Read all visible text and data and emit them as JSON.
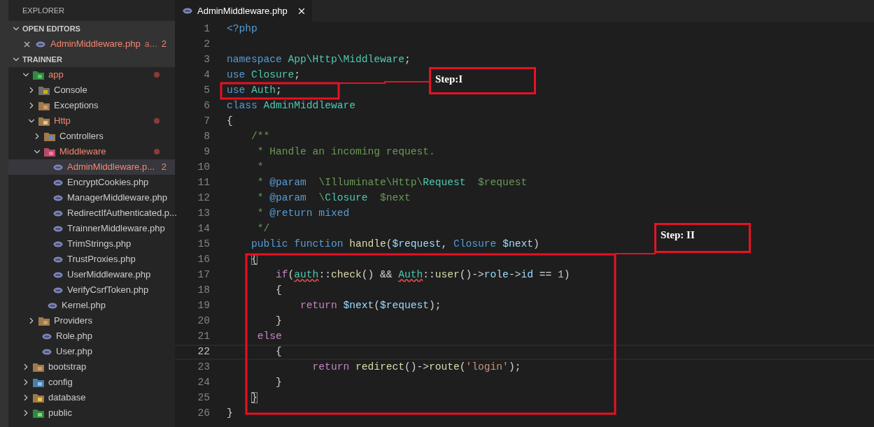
{
  "sidebar": {
    "title": "EXPLORER",
    "open_editors": {
      "title": "OPEN EDITORS",
      "expanded": true,
      "items": [
        {
          "label": "AdminMiddleware.php",
          "detail": "a…",
          "badge": "2",
          "problem": true
        }
      ]
    },
    "workspace": {
      "title": "TRAINNER",
      "expanded": true,
      "items": [
        {
          "label": "app",
          "kind": "folder-app",
          "expanded": true,
          "modified": true,
          "problem": true,
          "selected": false,
          "children": [
            {
              "label": "Console",
              "kind": "folder-console",
              "expanded": false,
              "modified": false,
              "problem": false,
              "selected": false
            },
            {
              "label": "Exceptions",
              "kind": "folder",
              "expanded": false,
              "modified": false,
              "problem": false,
              "selected": false
            },
            {
              "label": "Http",
              "kind": "folder-open",
              "expanded": true,
              "modified": true,
              "problem": true,
              "selected": false,
              "children": [
                {
                  "label": "Controllers",
                  "kind": "folder-controllers",
                  "expanded": false,
                  "modified": false,
                  "problem": false,
                  "selected": false
                },
                {
                  "label": "Middleware",
                  "kind": "folder-middleware",
                  "expanded": true,
                  "modified": true,
                  "problem": true,
                  "selected": false,
                  "children": [
                    {
                      "label": "AdminMiddleware.p...",
                      "kind": "php",
                      "badge": "2",
                      "modified": false,
                      "problem": true,
                      "selected": true
                    },
                    {
                      "label": "EncryptCookies.php",
                      "kind": "php",
                      "modified": false,
                      "problem": false,
                      "selected": false
                    },
                    {
                      "label": "ManagerMiddleware.php",
                      "kind": "php",
                      "modified": false,
                      "problem": false,
                      "selected": false
                    },
                    {
                      "label": "RedirectIfAuthenticated.p...",
                      "kind": "php",
                      "modified": false,
                      "problem": false,
                      "selected": false
                    },
                    {
                      "label": "TrainnerMiddleware.php",
                      "kind": "php",
                      "modified": false,
                      "problem": false,
                      "selected": false
                    },
                    {
                      "label": "TrimStrings.php",
                      "kind": "php",
                      "modified": false,
                      "problem": false,
                      "selected": false
                    },
                    {
                      "label": "TrustProxies.php",
                      "kind": "php",
                      "modified": false,
                      "problem": false,
                      "selected": false
                    },
                    {
                      "label": "UserMiddleware.php",
                      "kind": "php",
                      "modified": false,
                      "problem": false,
                      "selected": false
                    },
                    {
                      "label": "VerifyCsrfToken.php",
                      "kind": "php",
                      "modified": false,
                      "problem": false,
                      "selected": false
                    }
                  ]
                },
                {
                  "label": "Kernel.php",
                  "kind": "php",
                  "modified": false,
                  "problem": false,
                  "selected": false
                }
              ]
            },
            {
              "label": "Providers",
              "kind": "folder",
              "expanded": false,
              "modified": false,
              "problem": false,
              "selected": false
            },
            {
              "label": "Role.php",
              "kind": "php",
              "modified": false,
              "problem": false,
              "selected": false
            },
            {
              "label": "User.php",
              "kind": "php",
              "modified": false,
              "problem": false,
              "selected": false
            }
          ]
        },
        {
          "label": "bootstrap",
          "kind": "folder",
          "expanded": false,
          "modified": false,
          "problem": false,
          "selected": false
        },
        {
          "label": "config",
          "kind": "folder-config",
          "expanded": false,
          "modified": false,
          "problem": false,
          "selected": false
        },
        {
          "label": "database",
          "kind": "folder-database",
          "expanded": false,
          "modified": false,
          "problem": false,
          "selected": false
        },
        {
          "label": "public",
          "kind": "folder-public",
          "expanded": false,
          "modified": false,
          "problem": false,
          "selected": false
        }
      ]
    }
  },
  "tabs": [
    {
      "label": "AdminMiddleware.php",
      "selected": true
    }
  ],
  "editor": {
    "lines": [
      {
        "number": "1",
        "current": false,
        "tokens": [
          {
            "kind": "keyword",
            "text": "<?php"
          }
        ]
      },
      {
        "number": "2",
        "current": false
      },
      {
        "number": "3",
        "current": false,
        "tokens": [
          {
            "kind": "keyword",
            "text": "namespace"
          },
          {
            "kind": "type",
            "text": " App\\Http\\Middleware"
          },
          {
            "kind": "plain",
            "text": ";"
          }
        ]
      },
      {
        "number": "4",
        "current": false,
        "tokens": [
          {
            "kind": "keyword",
            "text": "use"
          },
          {
            "kind": "type",
            "text": " Closure"
          },
          {
            "kind": "plain",
            "text": ";"
          }
        ]
      },
      {
        "number": "5",
        "current": false,
        "tokens": [
          {
            "kind": "keyword",
            "text": "use"
          },
          {
            "kind": "type",
            "text": " Auth"
          },
          {
            "kind": "plain",
            "text": ";"
          }
        ]
      },
      {
        "number": "6",
        "current": false,
        "tokens": [
          {
            "kind": "keyword",
            "text": "class"
          },
          {
            "kind": "type",
            "text": " AdminMiddleware"
          }
        ]
      },
      {
        "number": "7",
        "current": false,
        "tokens": [
          {
            "kind": "plain",
            "text": "{"
          }
        ]
      },
      {
        "number": "8",
        "current": false,
        "tokens": [
          {
            "kind": "comment",
            "text": "    /**"
          }
        ]
      },
      {
        "number": "9",
        "current": false,
        "tokens": [
          {
            "kind": "comment",
            "text": "     * Handle an incoming request."
          }
        ]
      },
      {
        "number": "10",
        "current": false,
        "tokens": [
          {
            "kind": "comment",
            "text": "     *"
          }
        ]
      },
      {
        "number": "11",
        "current": false,
        "tokens": [
          {
            "kind": "comment",
            "text": "     * "
          },
          {
            "kind": "keyword",
            "text": "@param"
          },
          {
            "kind": "comment",
            "text": "  \\Illuminate\\Http\\"
          },
          {
            "kind": "type",
            "text": "Request"
          },
          {
            "kind": "comment",
            "text": "  $request"
          }
        ]
      },
      {
        "number": "12",
        "current": false,
        "tokens": [
          {
            "kind": "comment",
            "text": "     * "
          },
          {
            "kind": "keyword",
            "text": "@param"
          },
          {
            "kind": "comment",
            "text": "  \\"
          },
          {
            "kind": "type",
            "text": "Closure"
          },
          {
            "kind": "comment",
            "text": "  $next"
          }
        ]
      },
      {
        "number": "13",
        "current": false,
        "tokens": [
          {
            "kind": "comment",
            "text": "     * "
          },
          {
            "kind": "keyword",
            "text": "@return mixed"
          }
        ]
      },
      {
        "number": "14",
        "current": false,
        "tokens": [
          {
            "kind": "comment",
            "text": "     */"
          }
        ]
      },
      {
        "number": "15",
        "current": false,
        "tokens": [
          {
            "kind": "keyword",
            "text": "    public function"
          },
          {
            "kind": "function",
            "text": " handle"
          },
          {
            "kind": "plain",
            "text": "("
          },
          {
            "kind": "variable",
            "text": "$request"
          },
          {
            "kind": "plain",
            "text": ", "
          },
          {
            "kind": "keyword",
            "text": "Closure"
          },
          {
            "kind": "variable",
            "text": " $next"
          },
          {
            "kind": "plain",
            "text": ")"
          }
        ]
      },
      {
        "number": "16",
        "current": false,
        "tokens": [
          {
            "kind": "match",
            "text": "    {"
          }
        ]
      },
      {
        "number": "17",
        "current": false,
        "tokens": [
          {
            "kind": "control",
            "text": "        if"
          },
          {
            "kind": "plain",
            "text": "("
          },
          {
            "kind": "error",
            "text": "auth"
          },
          {
            "kind": "plain",
            "text": "::"
          },
          {
            "kind": "function",
            "text": "check"
          },
          {
            "kind": "plain",
            "text": "() && "
          },
          {
            "kind": "error",
            "text": "Auth"
          },
          {
            "kind": "plain",
            "text": "::"
          },
          {
            "kind": "function",
            "text": "user"
          },
          {
            "kind": "plain",
            "text": "()->"
          },
          {
            "kind": "variable",
            "text": "role"
          },
          {
            "kind": "plain",
            "text": "->"
          },
          {
            "kind": "variable",
            "text": "id"
          },
          {
            "kind": "plain",
            "text": " == "
          },
          {
            "kind": "number",
            "text": "1"
          },
          {
            "kind": "plain",
            "text": ")"
          }
        ]
      },
      {
        "number": "18",
        "current": false,
        "tokens": [
          {
            "kind": "plain",
            "text": "        {"
          }
        ]
      },
      {
        "number": "19",
        "current": false,
        "tokens": [
          {
            "kind": "control",
            "text": "            return"
          },
          {
            "kind": "variable",
            "text": " $next"
          },
          {
            "kind": "plain",
            "text": "("
          },
          {
            "kind": "variable",
            "text": "$request"
          },
          {
            "kind": "plain",
            "text": ");"
          }
        ]
      },
      {
        "number": "20",
        "current": false,
        "tokens": [
          {
            "kind": "plain",
            "text": "        }"
          }
        ]
      },
      {
        "number": "21",
        "current": false,
        "tokens": [
          {
            "kind": "control",
            "text": "     else"
          }
        ]
      },
      {
        "number": "22",
        "current": true,
        "tokens": [
          {
            "kind": "plain",
            "text": "        {"
          }
        ]
      },
      {
        "number": "23",
        "current": false,
        "tokens": [
          {
            "kind": "control",
            "text": "              return"
          },
          {
            "kind": "function",
            "text": " redirect"
          },
          {
            "kind": "plain",
            "text": "()->"
          },
          {
            "kind": "function",
            "text": "route"
          },
          {
            "kind": "plain",
            "text": "("
          },
          {
            "kind": "string",
            "text": "'login'"
          },
          {
            "kind": "plain",
            "text": ");"
          }
        ]
      },
      {
        "number": "24",
        "current": false,
        "tokens": [
          {
            "kind": "plain",
            "text": "        }"
          }
        ]
      },
      {
        "number": "25",
        "current": false,
        "tokens": [
          {
            "kind": "match",
            "text": "    }"
          }
        ]
      },
      {
        "number": "26",
        "current": false,
        "tokens": [
          {
            "kind": "plain",
            "text": "}"
          }
        ]
      }
    ]
  },
  "annotations": [
    {
      "label": "Step:I"
    },
    {
      "label": "Step: II"
    }
  ]
}
